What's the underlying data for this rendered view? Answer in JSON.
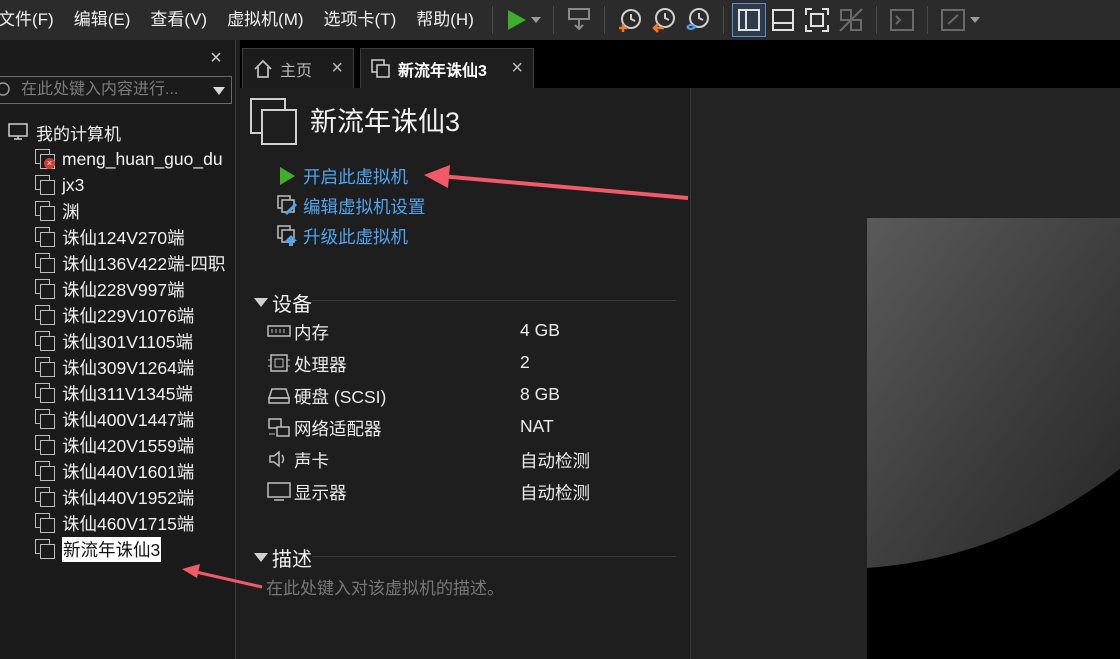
{
  "menubar": {
    "items": [
      "文件(F)",
      "编辑(E)",
      "查看(V)",
      "虚拟机(M)",
      "选项卡(T)",
      "帮助(H)"
    ]
  },
  "toolbar": {
    "buttons": [
      "play-icon",
      "send-keys-icon",
      "snapshot-icon",
      "revert-snapshot-icon",
      "snapshot-manager-icon",
      "library-view-icon",
      "thumbnail-view-icon",
      "fullscreen-icon",
      "unity-icon",
      "console-icon",
      "stretch-icon"
    ],
    "accent": "#3fae2a"
  },
  "library": {
    "close": "×",
    "search_placeholder": "在此处键入内容进行...",
    "root": "我的计算机",
    "vms": [
      {
        "name": "meng_huan_guo_du",
        "error": true
      },
      {
        "name": "jx3"
      },
      {
        "name": "渊"
      },
      {
        "name": "诛仙124V270端"
      },
      {
        "name": "诛仙136V422端-四职"
      },
      {
        "name": "诛仙228V997端"
      },
      {
        "name": "诛仙229V1076端"
      },
      {
        "name": "诛仙301V1105端"
      },
      {
        "name": "诛仙309V1264端"
      },
      {
        "name": "诛仙311V1345端"
      },
      {
        "name": "诛仙400V1447端"
      },
      {
        "name": "诛仙420V1559端"
      },
      {
        "name": "诛仙440V1601端"
      },
      {
        "name": "诛仙440V1952端"
      },
      {
        "name": "诛仙460V1715端"
      },
      {
        "name": "新流年诛仙3",
        "selected": true
      }
    ]
  },
  "tabs": [
    {
      "label": "主页",
      "close": "×"
    },
    {
      "label": "新流年诛仙3",
      "close": "×"
    }
  ],
  "main": {
    "title": "新流年诛仙3",
    "actions": [
      "开启此虚拟机",
      "编辑虚拟机设置",
      "升级此虚拟机"
    ],
    "devices_heading": "设备",
    "devices": [
      {
        "name": "内存",
        "value": "4 GB",
        "icon": "memory-icon"
      },
      {
        "name": "处理器",
        "value": "2",
        "icon": "cpu-icon"
      },
      {
        "name": "硬盘 (SCSI)",
        "value": "8 GB",
        "icon": "hard-disk-icon"
      },
      {
        "name": "网络适配器",
        "value": "NAT",
        "icon": "network-adapter-icon"
      },
      {
        "name": "声卡",
        "value": "自动检测",
        "icon": "sound-card-icon"
      },
      {
        "name": "显示器",
        "value": "自动检测",
        "icon": "display-icon"
      }
    ],
    "description_heading": "描述",
    "description_placeholder": "在此处键入对该虚拟机的描述。"
  },
  "colors": {
    "link": "#4ea6f0",
    "annotation_arrow": "#f25a6a",
    "play_green": "#3fae2a"
  }
}
